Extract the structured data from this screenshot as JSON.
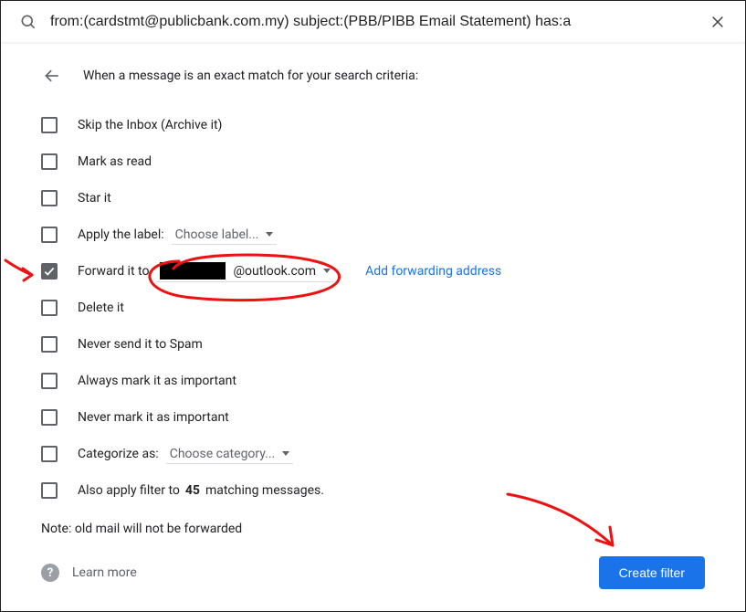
{
  "search": {
    "query": "from:(cardstmt@publicbank.com.my) subject:(PBB/PIBB Email Statement) has:a"
  },
  "header": {
    "title": "When a message is an exact match for your search criteria:"
  },
  "options": {
    "skip_inbox": {
      "label": "Skip the Inbox (Archive it)",
      "checked": false
    },
    "mark_read": {
      "label": "Mark as read",
      "checked": false
    },
    "star": {
      "label": "Star it",
      "checked": false
    },
    "apply_label": {
      "label_prefix": "Apply the label:",
      "select_text": "Choose label...",
      "checked": false
    },
    "forward": {
      "label_prefix": "Forward it to",
      "dest_prefix_redacted": true,
      "dest_suffix": "@outlook.com",
      "add_forward_link": "Add forwarding address",
      "checked": true
    },
    "delete": {
      "label": "Delete it",
      "checked": false
    },
    "never_spam": {
      "label": "Never send it to Spam",
      "checked": false
    },
    "always_important": {
      "label": "Always mark it as important",
      "checked": false
    },
    "never_important": {
      "label": "Never mark it as important",
      "checked": false
    },
    "categorize": {
      "label_prefix": "Categorize as:",
      "select_text": "Choose category...",
      "checked": false
    },
    "also_apply": {
      "label_before": "Also apply filter to ",
      "count": "45",
      "label_after": " matching messages.",
      "checked": false
    }
  },
  "note": "Note: old mail will not be forwarded",
  "footer": {
    "learn_more": "Learn more",
    "create_filter": "Create filter"
  }
}
